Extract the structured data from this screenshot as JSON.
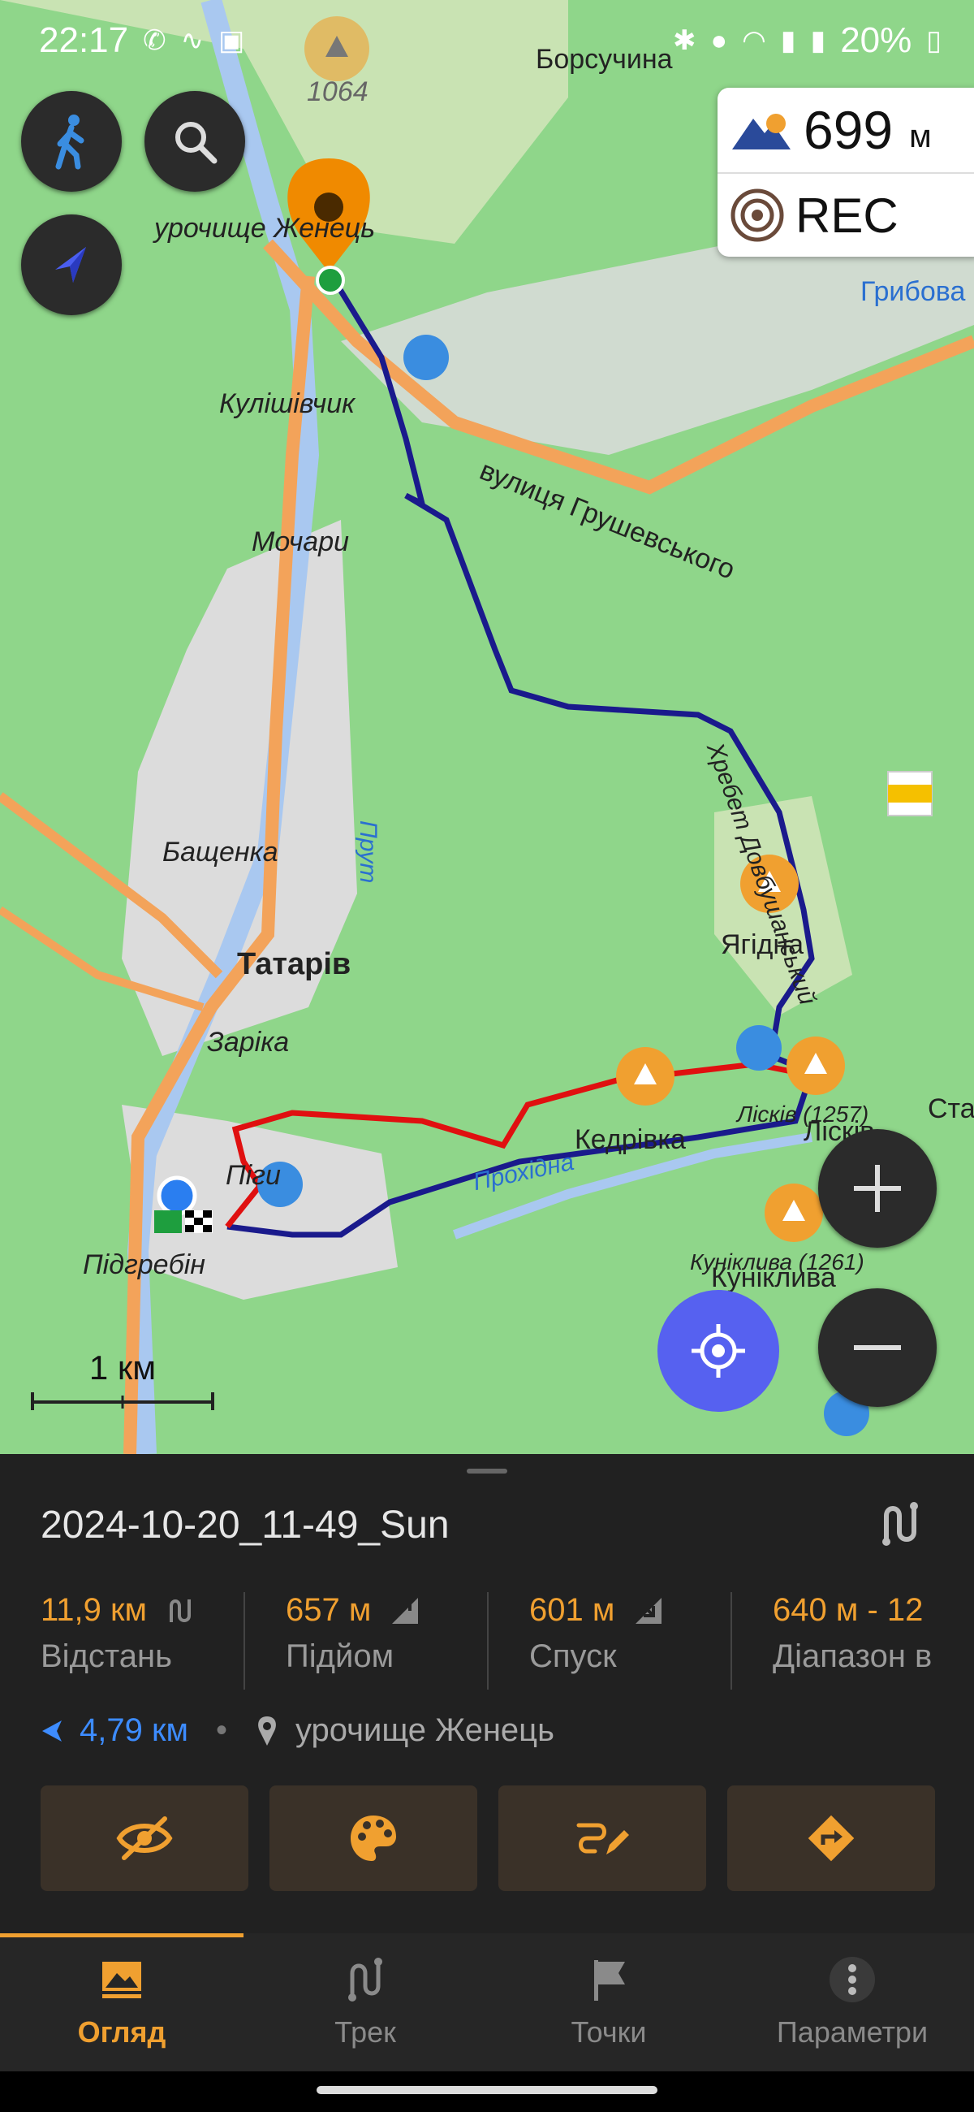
{
  "status_bar": {
    "time": "22:17",
    "battery": "20%"
  },
  "map": {
    "labels": {
      "peak_elevation": "1064",
      "borsuchyna": "Борсучина",
      "hrybova": "Грибова",
      "urochyshche": "урочище Женець",
      "kulishivchyk": "Кулішівчик",
      "street": "вулиця Грушевського",
      "mochary": "Мочари",
      "khrebet": "Хребет Довбушанський",
      "bashchenka": "Бащенка",
      "prut": "Прут",
      "tatariv": "Татарів",
      "yahidna": "Ягідна",
      "zarika": "Зарiка",
      "lisniv_peak": "Лісків (1257)",
      "lisniv": "Лісків",
      "sta": "Ста",
      "kedrivka": "Кедрівка",
      "pihy": "Піги",
      "prokhidna": "Прохідна",
      "kuniklyva_peak": "Куніклива (1261)",
      "kuniklyva": "Куніклива",
      "pidhrebin": "Підгребін"
    },
    "widget": {
      "altitude": "699",
      "altitude_unit": "м",
      "rec_label": "REC"
    },
    "scale_label": "1 км"
  },
  "track": {
    "name": "2024-10-20_11-49_Sun",
    "stats": [
      {
        "value": "11,9 км",
        "label": "Відстань",
        "icon": "route-icon"
      },
      {
        "value": "657 м",
        "label": "Підйом",
        "icon": "arrow-up-right-icon"
      },
      {
        "value": "601 м",
        "label": "Спуск",
        "icon": "arrow-down-right-icon"
      },
      {
        "value": "640 м - 12",
        "label": "Діапазон в",
        "icon": ""
      }
    ],
    "distance_to": "4,79 км",
    "location": "урочище Женець"
  },
  "tabs": [
    {
      "label": "Огляд",
      "icon": "overview-icon",
      "active": true
    },
    {
      "label": "Трек",
      "icon": "track-icon",
      "active": false
    },
    {
      "label": "Точки",
      "icon": "flag-icon",
      "active": false
    },
    {
      "label": "Параметри",
      "icon": "more-icon",
      "active": false
    }
  ],
  "colors": {
    "accent": "#f0a030",
    "map_green": "#8fd68a",
    "track_red": "#e01010",
    "track_blue": "#1a1a8c",
    "locate_blue": "#5661f0"
  }
}
